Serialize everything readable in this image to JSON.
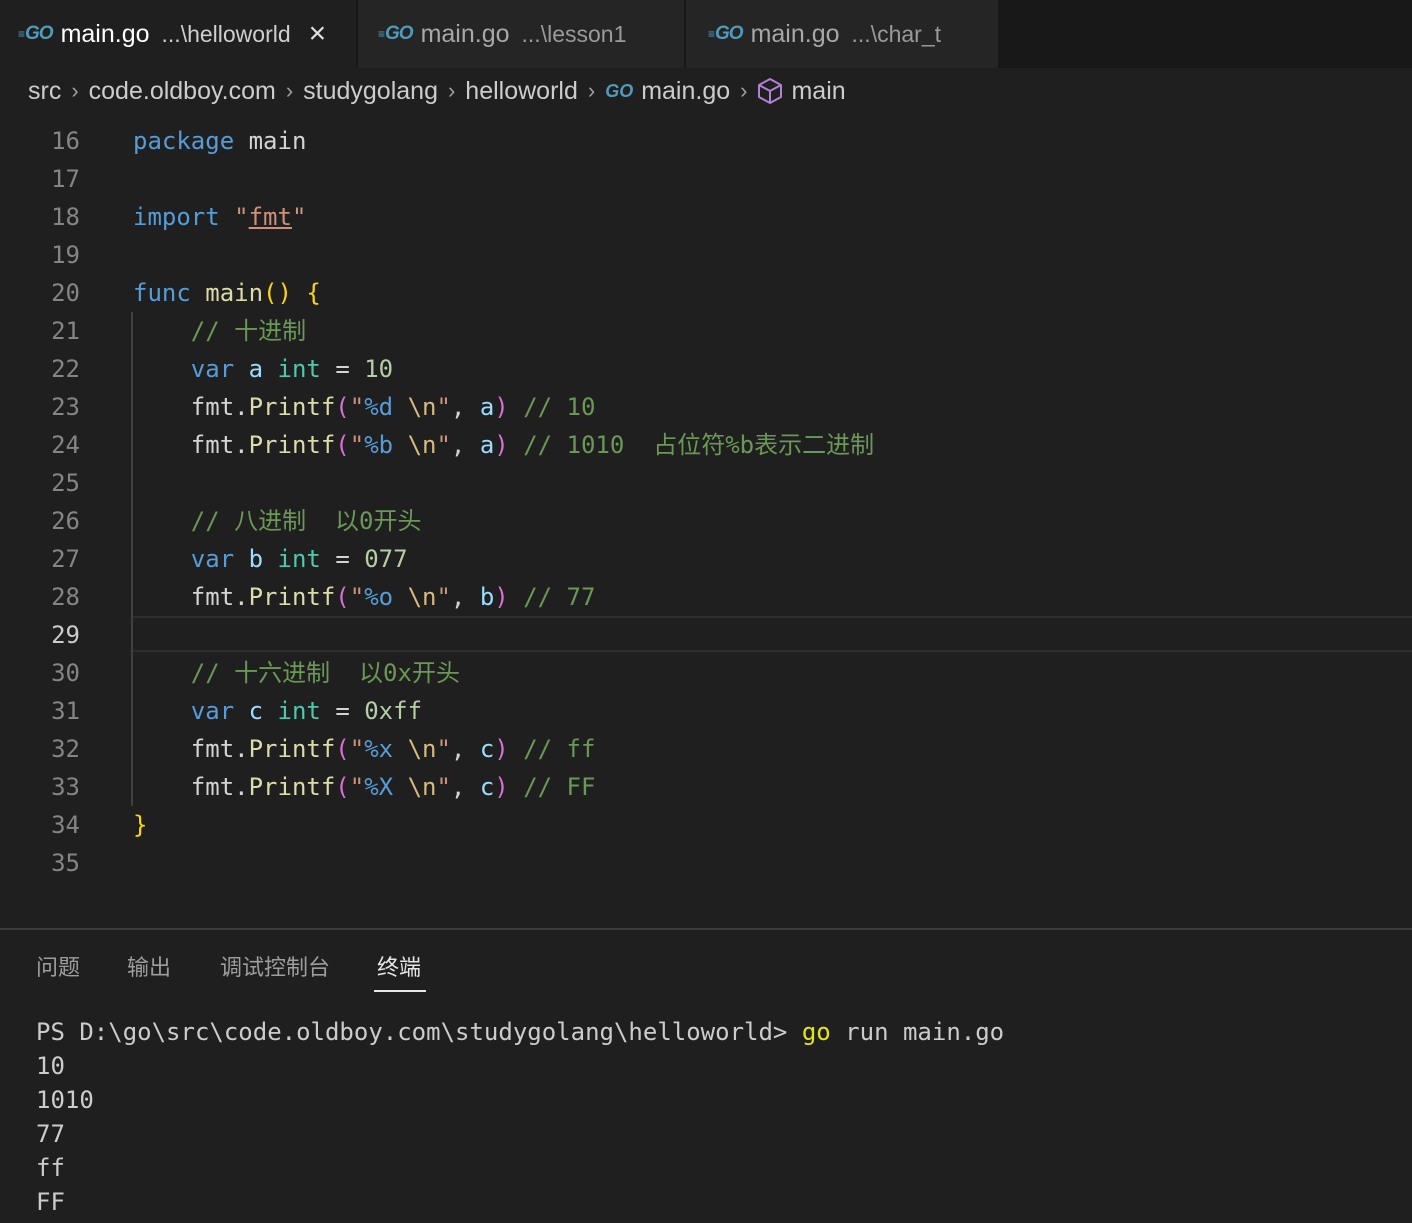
{
  "tabs": [
    {
      "name": "main.go",
      "desc": "...\\helloworld",
      "icon": "go-file-icon",
      "active": true
    },
    {
      "name": "main.go",
      "desc": "...\\lesson1",
      "icon": "go-file-icon",
      "active": false
    },
    {
      "name": "main.go",
      "desc": "...\\char_t",
      "icon": "go-file-icon",
      "active": false
    }
  ],
  "tab_icon_text": "GO",
  "close_icon": "×",
  "breadcrumb": {
    "items": [
      "src",
      "code.oldboy.com",
      "studygolang",
      "helloworld",
      "main.go",
      "main"
    ],
    "separator": "›"
  },
  "editor": {
    "current_line": "29",
    "lines": [
      {
        "n": "16",
        "tokens": [
          [
            "kw",
            "package"
          ],
          [
            "plain",
            " "
          ],
          [
            "plain",
            "main"
          ]
        ]
      },
      {
        "n": "17",
        "tokens": []
      },
      {
        "n": "18",
        "tokens": [
          [
            "kw",
            "import"
          ],
          [
            "plain",
            " "
          ],
          [
            "str",
            "\""
          ],
          [
            "struline",
            "fmt"
          ],
          [
            "str",
            "\""
          ]
        ]
      },
      {
        "n": "19",
        "tokens": []
      },
      {
        "n": "20",
        "tokens": [
          [
            "kw",
            "func"
          ],
          [
            "plain",
            " "
          ],
          [
            "fn",
            "main"
          ],
          [
            "br1",
            "()"
          ],
          [
            "plain",
            " "
          ],
          [
            "br1",
            "{"
          ]
        ]
      },
      {
        "n": "21",
        "tokens": [
          [
            "plain",
            "    "
          ],
          [
            "cm",
            "// 十进制"
          ]
        ]
      },
      {
        "n": "22",
        "tokens": [
          [
            "plain",
            "    "
          ],
          [
            "kw",
            "var"
          ],
          [
            "plain",
            " "
          ],
          [
            "id",
            "a"
          ],
          [
            "plain",
            " "
          ],
          [
            "ty",
            "int"
          ],
          [
            "plain",
            " = "
          ],
          [
            "num",
            "10"
          ]
        ]
      },
      {
        "n": "23",
        "tokens": [
          [
            "plain",
            "    "
          ],
          [
            "plain",
            "fmt."
          ],
          [
            "fn",
            "Printf"
          ],
          [
            "br2",
            "("
          ],
          [
            "str",
            "\""
          ],
          [
            "fmtv",
            "%d"
          ],
          [
            "plain",
            " "
          ],
          [
            "esc",
            "\\n"
          ],
          [
            "str",
            "\""
          ],
          [
            "plain",
            ", "
          ],
          [
            "id",
            "a"
          ],
          [
            "br2",
            ")"
          ],
          [
            "plain",
            " "
          ],
          [
            "cm",
            "// 10"
          ]
        ]
      },
      {
        "n": "24",
        "tokens": [
          [
            "plain",
            "    "
          ],
          [
            "plain",
            "fmt."
          ],
          [
            "fn",
            "Printf"
          ],
          [
            "br2",
            "("
          ],
          [
            "str",
            "\""
          ],
          [
            "fmtv",
            "%b"
          ],
          [
            "plain",
            " "
          ],
          [
            "esc",
            "\\n"
          ],
          [
            "str",
            "\""
          ],
          [
            "plain",
            ", "
          ],
          [
            "id",
            "a"
          ],
          [
            "br2",
            ")"
          ],
          [
            "plain",
            " "
          ],
          [
            "cm",
            "// 1010  占位符%b表示二进制"
          ]
        ]
      },
      {
        "n": "25",
        "tokens": []
      },
      {
        "n": "26",
        "tokens": [
          [
            "plain",
            "    "
          ],
          [
            "cm",
            "// 八进制  以0开头"
          ]
        ]
      },
      {
        "n": "27",
        "tokens": [
          [
            "plain",
            "    "
          ],
          [
            "kw",
            "var"
          ],
          [
            "plain",
            " "
          ],
          [
            "id",
            "b"
          ],
          [
            "plain",
            " "
          ],
          [
            "ty",
            "int"
          ],
          [
            "plain",
            " = "
          ],
          [
            "num",
            "077"
          ]
        ]
      },
      {
        "n": "28",
        "tokens": [
          [
            "plain",
            "    "
          ],
          [
            "plain",
            "fmt."
          ],
          [
            "fn",
            "Printf"
          ],
          [
            "br2",
            "("
          ],
          [
            "str",
            "\""
          ],
          [
            "fmtv",
            "%o"
          ],
          [
            "plain",
            " "
          ],
          [
            "esc",
            "\\n"
          ],
          [
            "str",
            "\""
          ],
          [
            "plain",
            ", "
          ],
          [
            "id",
            "b"
          ],
          [
            "br2",
            ")"
          ],
          [
            "plain",
            " "
          ],
          [
            "cm",
            "// 77"
          ]
        ]
      },
      {
        "n": "29",
        "tokens": []
      },
      {
        "n": "30",
        "tokens": [
          [
            "plain",
            "    "
          ],
          [
            "cm",
            "// 十六进制  以0x开头"
          ]
        ]
      },
      {
        "n": "31",
        "tokens": [
          [
            "plain",
            "    "
          ],
          [
            "kw",
            "var"
          ],
          [
            "plain",
            " "
          ],
          [
            "id",
            "c"
          ],
          [
            "plain",
            " "
          ],
          [
            "ty",
            "int"
          ],
          [
            "plain",
            " = "
          ],
          [
            "num",
            "0xff"
          ]
        ]
      },
      {
        "n": "32",
        "tokens": [
          [
            "plain",
            "    "
          ],
          [
            "plain",
            "fmt."
          ],
          [
            "fn",
            "Printf"
          ],
          [
            "br2",
            "("
          ],
          [
            "str",
            "\""
          ],
          [
            "fmtv",
            "%x"
          ],
          [
            "plain",
            " "
          ],
          [
            "esc",
            "\\n"
          ],
          [
            "str",
            "\""
          ],
          [
            "plain",
            ", "
          ],
          [
            "id",
            "c"
          ],
          [
            "br2",
            ")"
          ],
          [
            "plain",
            " "
          ],
          [
            "cm",
            "// ff"
          ]
        ]
      },
      {
        "n": "33",
        "tokens": [
          [
            "plain",
            "    "
          ],
          [
            "plain",
            "fmt."
          ],
          [
            "fn",
            "Printf"
          ],
          [
            "br2",
            "("
          ],
          [
            "str",
            "\""
          ],
          [
            "fmtv",
            "%X"
          ],
          [
            "plain",
            " "
          ],
          [
            "esc",
            "\\n"
          ],
          [
            "str",
            "\""
          ],
          [
            "plain",
            ", "
          ],
          [
            "id",
            "c"
          ],
          [
            "br2",
            ")"
          ],
          [
            "plain",
            " "
          ],
          [
            "cm",
            "// FF"
          ]
        ]
      },
      {
        "n": "34",
        "tokens": [
          [
            "br1",
            "}"
          ]
        ]
      },
      {
        "n": "35",
        "tokens": []
      }
    ]
  },
  "panel": {
    "tabs": [
      "问题",
      "输出",
      "调试控制台",
      "终端"
    ],
    "active_tab": "终端"
  },
  "terminal": {
    "prompt": "PS D:\\go\\src\\code.oldboy.com\\studygolang\\helloworld> ",
    "command_head": "go",
    "command_rest": " run main.go",
    "output": [
      "10",
      "1010",
      "77",
      "ff",
      "FF"
    ]
  },
  "colors": {
    "keyword": "#569cd6",
    "type": "#4ec9b0",
    "function": "#dcdcaa",
    "string": "#ce9178",
    "number": "#b5cea8",
    "comment": "#6a9955",
    "go_brand": "#519aba"
  }
}
